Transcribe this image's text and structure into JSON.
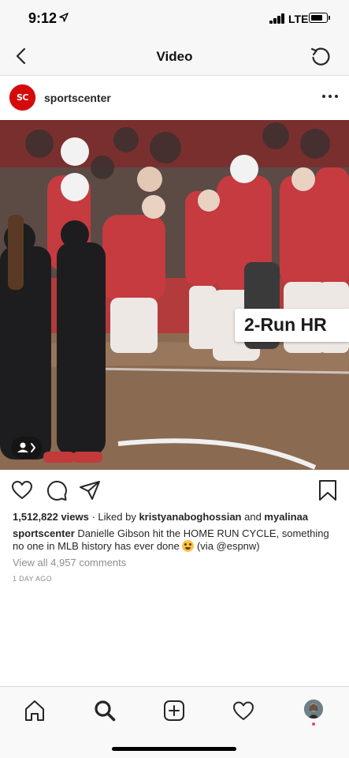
{
  "status": {
    "time": "9:12",
    "network": "LTE"
  },
  "header": {
    "title": "Video"
  },
  "post": {
    "account": "sportscenter",
    "avatar_text": "SC",
    "video_overlay": "2-Run HR",
    "views": "1,512,822 views",
    "liked_by_prefix": " · Liked by ",
    "liked_user_1": "kristyanaboghossian",
    "liked_and": " and ",
    "liked_user_2": "myalinaa",
    "caption_user": "sportscenter",
    "caption_text": " Danielle Gibson hit the HOME RUN CYCLE, something no one in MLB history has ever done ",
    "caption_via": " (via @espnw)",
    "view_comments": "View all 4,957 comments",
    "time_ago": "1 DAY AGO"
  },
  "icons": {
    "back": "chevron-left-icon",
    "refresh": "refresh-icon",
    "more": "more-icon",
    "like": "heart-icon",
    "comment": "comment-icon",
    "share": "send-icon",
    "save": "bookmark-icon",
    "tag": "user-tag-icon",
    "emoji": "exploding-head-emoji-icon"
  },
  "tabs": [
    "home",
    "search",
    "new-post",
    "activity",
    "profile"
  ],
  "colors": {
    "accent": "#d50a0a",
    "text": "#262626",
    "muted": "#8e8e8e",
    "notification": "#ed4956"
  }
}
